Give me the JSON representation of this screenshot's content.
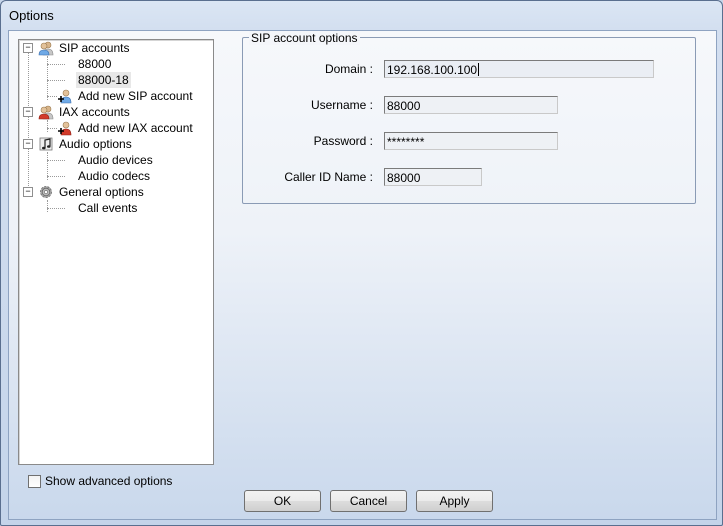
{
  "window": {
    "title": "Options"
  },
  "tree": {
    "items": [
      {
        "label": "SIP accounts",
        "icon": "sip-accounts-icon",
        "expander": "−"
      },
      {
        "label": "88000"
      },
      {
        "label": "88000-18",
        "selected": true
      },
      {
        "label": "Add new SIP account",
        "icon": "add-sip-account-icon"
      },
      {
        "label": "IAX accounts",
        "icon": "iax-accounts-icon",
        "expander": "−"
      },
      {
        "label": "Add new IAX account",
        "icon": "add-iax-account-icon"
      },
      {
        "label": "Audio options",
        "icon": "audio-options-icon",
        "expander": "−"
      },
      {
        "label": "Audio devices"
      },
      {
        "label": "Audio codecs"
      },
      {
        "label": "General options",
        "icon": "gear-icon",
        "expander": "−"
      },
      {
        "label": "Call events"
      }
    ]
  },
  "sip_options": {
    "group_title": "SIP account options",
    "domain_label": "Domain :",
    "domain_value": "192.168.100.100",
    "username_label": "Username :",
    "username_value": "88000",
    "password_label": "Password :",
    "password_value": "********",
    "caller_id_label": "Caller ID Name :",
    "caller_id_value": "88000"
  },
  "options": {
    "show_advanced_label": "Show advanced options",
    "show_advanced_checked": false
  },
  "buttons": {
    "ok": "OK",
    "cancel": "Cancel",
    "apply": "Apply"
  },
  "colors": {
    "window_border": "#5a6f8f",
    "selection": "#e8e8e8",
    "group_border": "#8a9bb5"
  }
}
